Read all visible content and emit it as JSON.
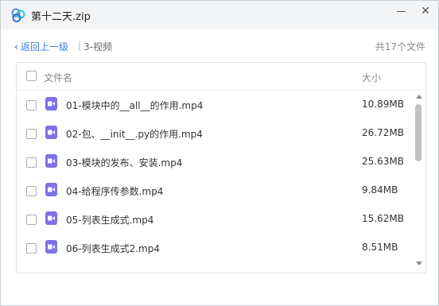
{
  "window": {
    "title": "第十二天.zip"
  },
  "nav": {
    "back_label": "返回上一级",
    "separator": "|",
    "crumb": "3-视频",
    "file_count": "共17个文件"
  },
  "table": {
    "header_name": "文件名",
    "header_size": "大小",
    "rows": [
      {
        "name": "01-模块中的__all__的作用.mp4",
        "size": "10.89MB",
        "icon": "video-file-icon"
      },
      {
        "name": "02-包、__init__.py的作用.mp4",
        "size": "26.72MB",
        "icon": "video-file-icon"
      },
      {
        "name": "03-模块的发布、安装.mp4",
        "size": "25.63MB",
        "icon": "video-file-icon"
      },
      {
        "name": "04-给程序传参数.mp4",
        "size": "9.84MB",
        "icon": "video-file-icon"
      },
      {
        "name": "05-列表生成式.mp4",
        "size": "15.62MB",
        "icon": "video-file-icon"
      },
      {
        "name": "06-列表生成式2.mp4",
        "size": "8.51MB",
        "icon": "video-file-icon"
      }
    ]
  },
  "colors": {
    "accent": "#3b7de6",
    "video_icon": "#7d72e6",
    "titlebar": "#f3f4f6"
  }
}
